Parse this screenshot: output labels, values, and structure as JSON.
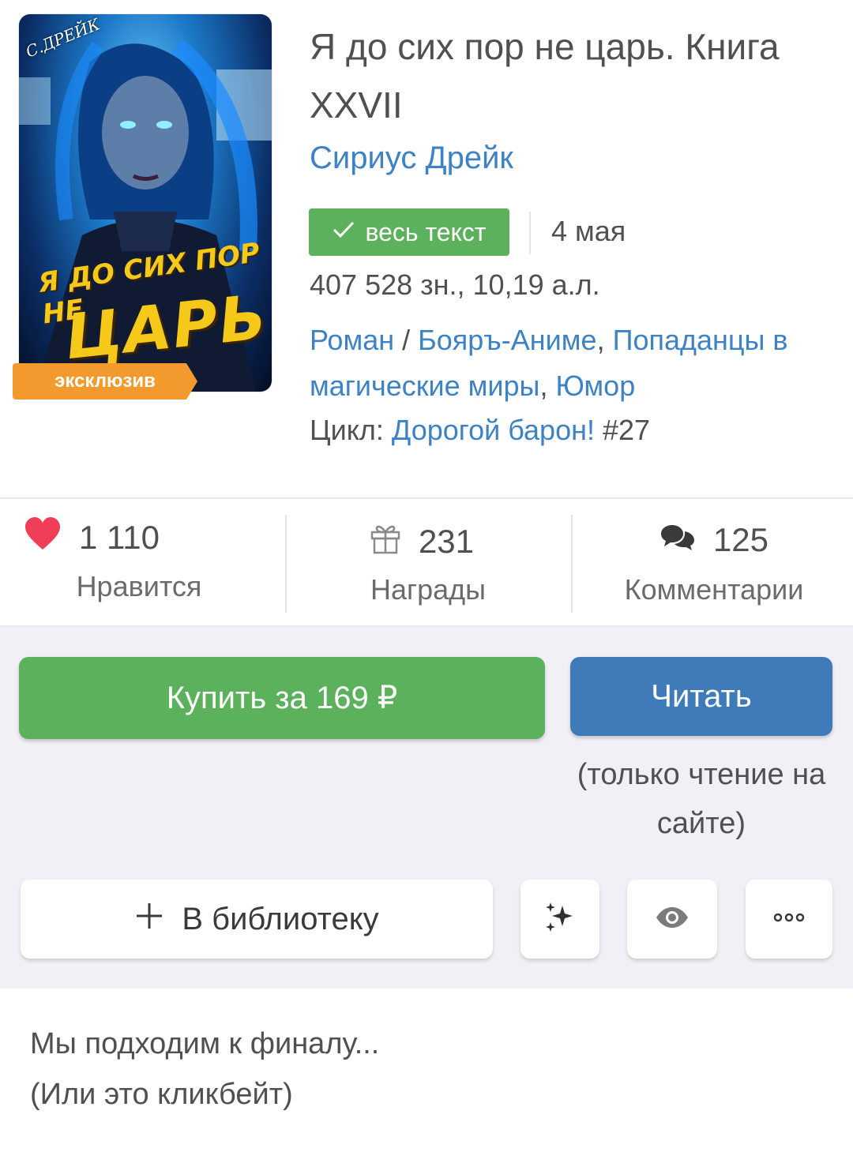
{
  "book": {
    "cover": {
      "author_text": "С.ДРЕЙК",
      "title_line1": "Я ДО СИХ ПОР НЕ",
      "title_line2": "ЦАРЬ",
      "badge": "эксклюзив"
    },
    "title": "Я до сих пор не царь. Книга XXVII",
    "author": "Сириус Дрейк",
    "status_badge": "весь текст",
    "date": "4 мая",
    "size": "407 528 зн., 10,19 а.л.",
    "genres": {
      "genre_1": "Роман",
      "separator": " / ",
      "genre_2": "Бояръ-Аниме",
      "comma_1": ", ",
      "genre_3": "Попаданцы в магические миры",
      "comma_2": ", ",
      "genre_4": "Юмор"
    },
    "cycle": {
      "label": "Цикл: ",
      "name": "Дорогой барон!",
      "number": " #27"
    }
  },
  "stats": {
    "likes": {
      "count": "1 110",
      "label": "Нравится",
      "icon": "heart-icon"
    },
    "awards": {
      "count": "231",
      "label": "Награды",
      "icon": "gift-icon"
    },
    "comments": {
      "count": "125",
      "label": "Комментарии",
      "icon": "comments-icon"
    }
  },
  "actions": {
    "buy_label": "Купить за 169 ₽",
    "read_label": "Читать",
    "read_note": "(только чтение на сайте)",
    "library_label": "В библиотеку",
    "library_icon": "plus-icon",
    "icon_buttons": [
      "sparkles-icon",
      "eye-icon",
      "more-icon"
    ]
  },
  "annotation": {
    "line1": "Мы подходим к финалу...",
    "line2": "(Или это кликбейт)"
  },
  "colors": {
    "accent_green": "#5cb15c",
    "accent_blue": "#3f7ab9",
    "link": "#3d82c4",
    "exclusive_orange": "#f29a2e",
    "heart_red": "#ef3e55"
  }
}
